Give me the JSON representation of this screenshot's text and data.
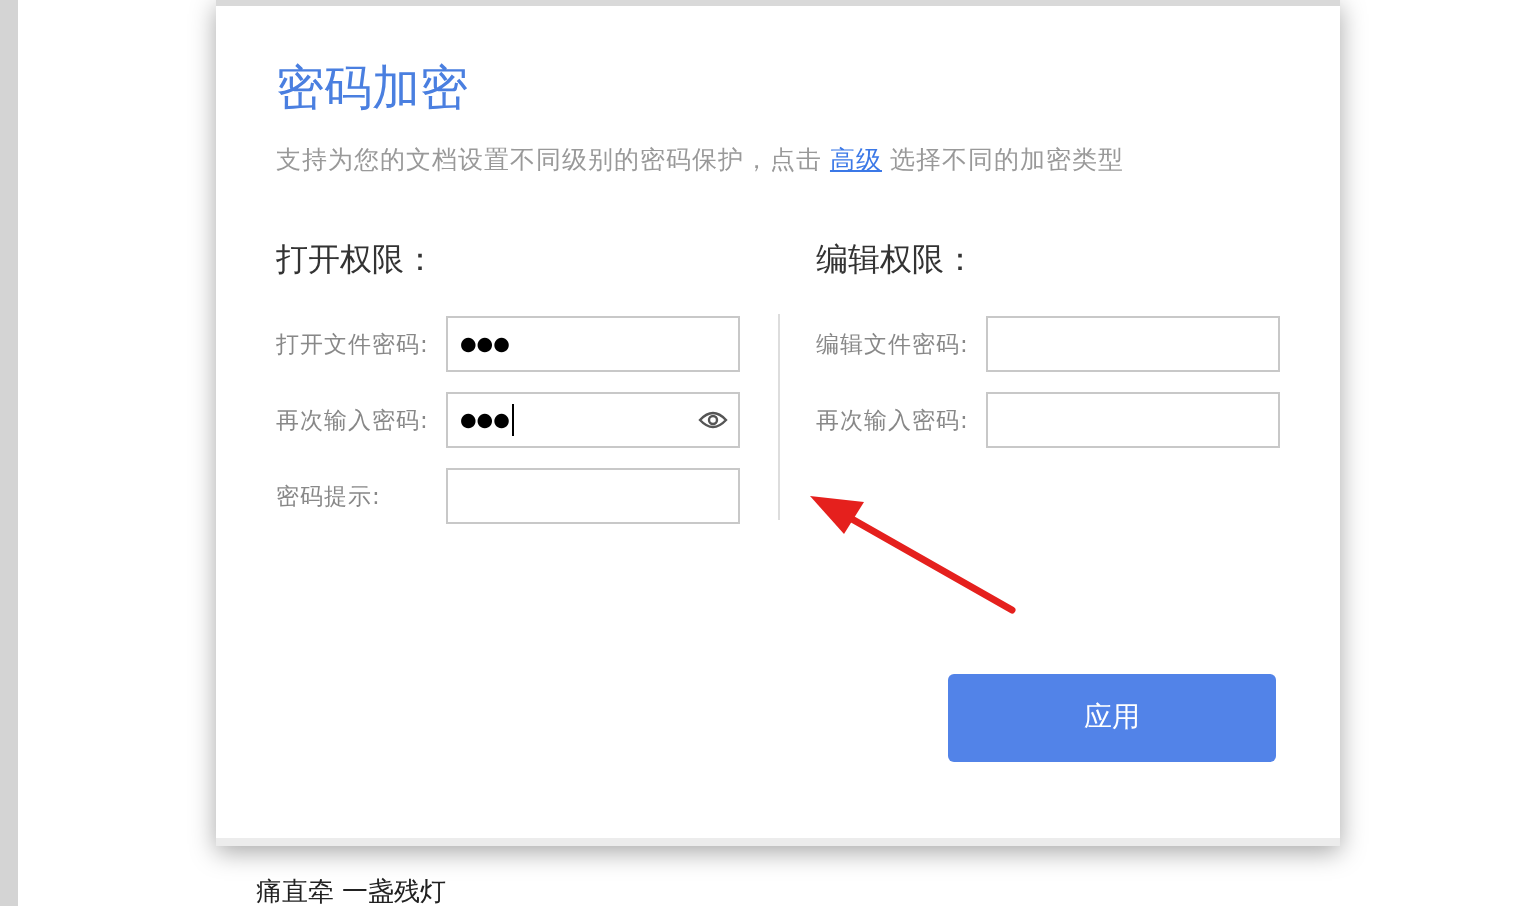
{
  "dialog": {
    "title": "密码加密",
    "description": {
      "before": "支持为您的文档设置不同级别的密码保护，点击 ",
      "link": "高级",
      "after": " 选择不同的加密类型"
    },
    "sections": [
      {
        "heading": "打开权限：",
        "fields": [
          {
            "label": "打开文件密码:",
            "value": "●●●",
            "focused": false,
            "reveal_icon": false
          },
          {
            "label": "再次输入密码:",
            "value": "●●●",
            "focused": true,
            "reveal_icon": true
          },
          {
            "label": "密码提示:",
            "focused": false,
            "reveal_icon": false
          }
        ]
      },
      {
        "heading": "编辑权限：",
        "fields": [
          {
            "label": "编辑文件密码:",
            "focused": false,
            "reveal_icon": false
          },
          {
            "label": "再次输入密码:",
            "focused": false,
            "reveal_icon": false
          }
        ]
      }
    ],
    "apply_button": "应用"
  },
  "document_text": "痛直牵 一盏残灯"
}
